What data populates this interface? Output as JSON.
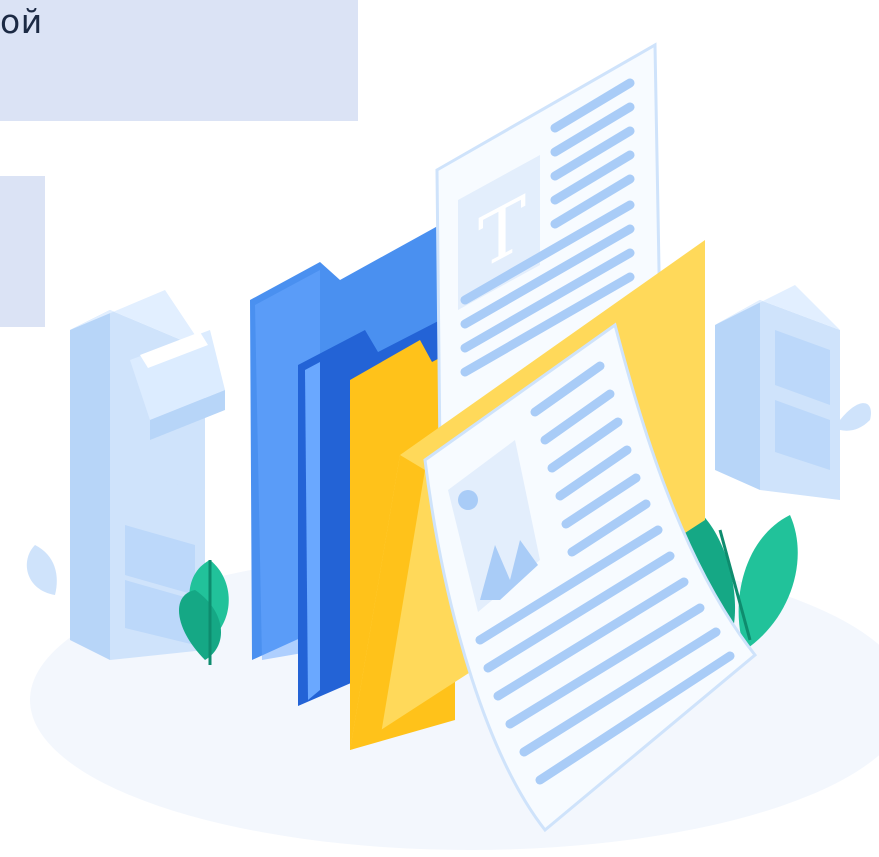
{
  "top_panel": {
    "text": "ой"
  },
  "illustration": {
    "icons": [
      "filing-cabinet-icon",
      "folder-icon",
      "text-document-icon",
      "image-document-icon",
      "plant-icon"
    ],
    "colors": {
      "panel": "#dbe3f5",
      "blue_light": "#4a90f0",
      "blue_dark": "#2363d6",
      "yellow": "#ffc21a",
      "yellow_light": "#ffd95a",
      "cabinet": "#cfe3fb",
      "paper": "#f7fbff",
      "lines": "#a9ccf7",
      "leaf_green": "#21c29a"
    }
  }
}
